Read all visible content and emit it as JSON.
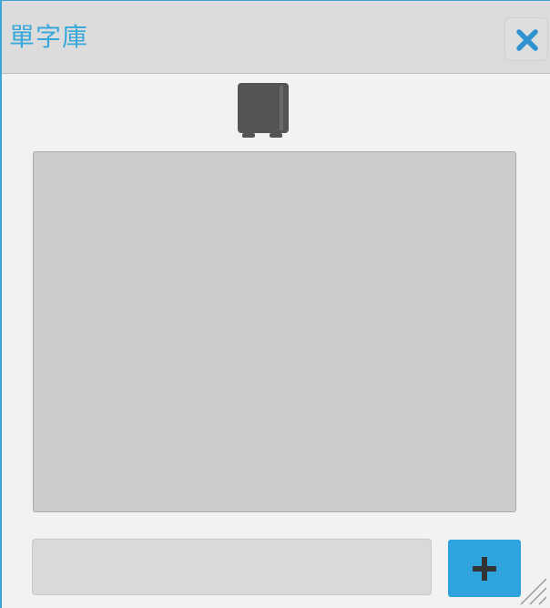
{
  "dialog": {
    "title": "單字庫",
    "close_icon": "close-icon"
  },
  "toolbar": {
    "speaker_icon": "speaker-icon"
  },
  "word_list": {
    "items": []
  },
  "word_input": {
    "value": "",
    "placeholder": ""
  },
  "add_button": {
    "icon": "plus-icon"
  },
  "colors": {
    "accent": "#2ea3dd",
    "title_text": "#38a8dc",
    "titlebar_bg": "#dcdcdc",
    "body_bg": "#f2f2f2",
    "list_bg": "#cccccc",
    "input_bg": "#d9d9d9",
    "icon_dark": "#555555"
  }
}
